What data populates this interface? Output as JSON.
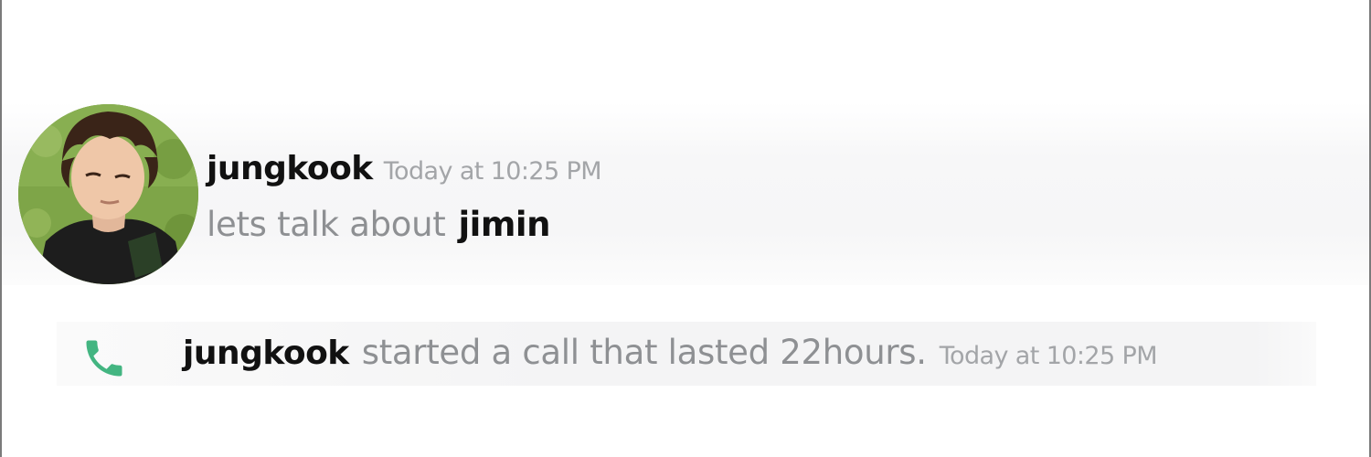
{
  "message": {
    "username": "jungkook",
    "timestamp": "Today at 10:25 PM",
    "text": "lets talk about",
    "mention": "jimin"
  },
  "call": {
    "icon": "phone-icon",
    "username": "jungkook",
    "text": "started a call that lasted 22hours.",
    "timestamp": "Today at 10:25 PM"
  },
  "colors": {
    "username": "#111111",
    "muted_text": "#8e9093",
    "timestamp": "#a3a5a8",
    "call_icon": "#43b581"
  }
}
